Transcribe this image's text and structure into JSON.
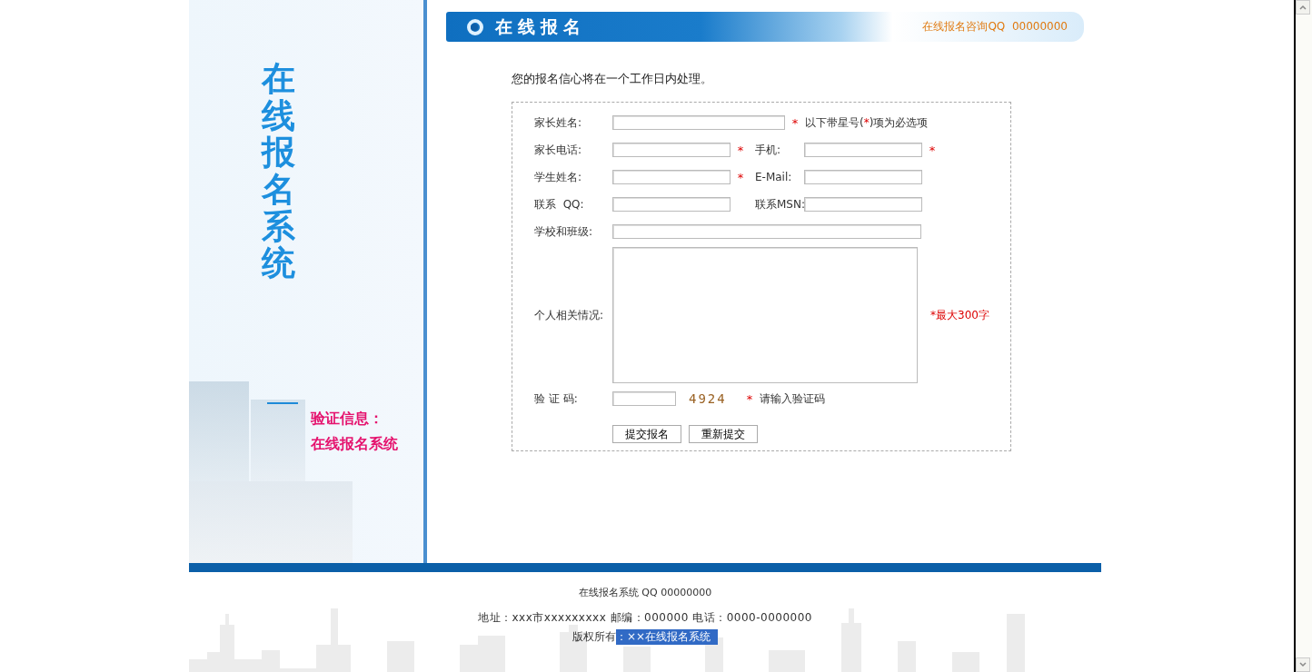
{
  "sidebar": {
    "title": "在线报名系统",
    "info_label": "验证信息：",
    "info_value": "在线报名系统"
  },
  "header": {
    "title": "在线报名",
    "consult": "在线报名咨询QQ  00000000"
  },
  "intro": "您的报名信心将在一个工作日内处理。",
  "form": {
    "rows": [
      {
        "kind": "single",
        "fields": [
          {
            "label": "家长姓名:",
            "mark": "*"
          }
        ],
        "note": [
          "以下带星号(",
          "*",
          ")项为必选项"
        ]
      },
      {
        "kind": "pair",
        "fields": [
          {
            "label": "家长电话:",
            "mark": "*"
          },
          {
            "label": "手机:",
            "mark": "*"
          }
        ]
      },
      {
        "kind": "pair",
        "fields": [
          {
            "label": "学生姓名:",
            "mark": "*"
          },
          {
            "label": "E-Mail:"
          }
        ]
      },
      {
        "kind": "pair",
        "fields": [
          {
            "label": "联系  QQ:"
          },
          {
            "label": "联系MSN:"
          }
        ]
      },
      {
        "kind": "wide",
        "fields": [
          {
            "label": "学校和班级:"
          }
        ]
      },
      {
        "kind": "textarea",
        "fields": [
          {
            "label": "个人相关情况:"
          }
        ],
        "hint": "*最大300字"
      },
      {
        "kind": "captcha",
        "fields": [
          {
            "label": "验 证 码:",
            "mark": "*"
          }
        ],
        "code": "4924",
        "note": [
          "请输入验证码"
        ]
      },
      {
        "kind": "buttons",
        "buttons": [
          "提交报名",
          "重新提交"
        ]
      }
    ]
  },
  "footer": {
    "line1": "在线报名系统 QQ 00000000",
    "address": "地址：xxx市xxxxxxxxx 邮编：000000 电话：0000-0000000",
    "copyright_label": "版权所有",
    "copyright_owner": {
      "text": "：××在线报名系统",
      "selected": true
    }
  }
}
